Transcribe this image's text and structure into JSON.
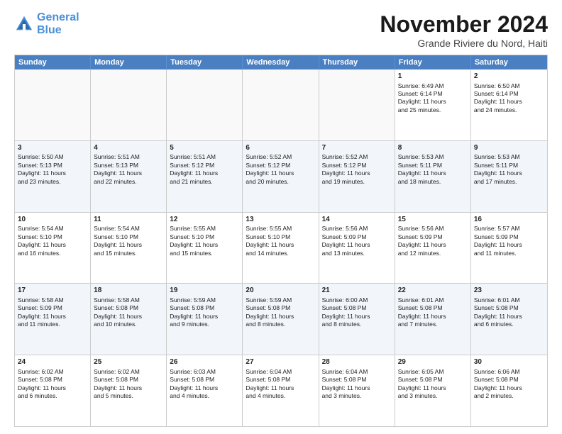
{
  "logo": {
    "line1": "General",
    "line2": "Blue"
  },
  "title": "November 2024",
  "location": "Grande Riviere du Nord, Haiti",
  "header_days": [
    "Sunday",
    "Monday",
    "Tuesday",
    "Wednesday",
    "Thursday",
    "Friday",
    "Saturday"
  ],
  "rows": [
    [
      {
        "day": "",
        "info": ""
      },
      {
        "day": "",
        "info": ""
      },
      {
        "day": "",
        "info": ""
      },
      {
        "day": "",
        "info": ""
      },
      {
        "day": "",
        "info": ""
      },
      {
        "day": "1",
        "info": "Sunrise: 6:49 AM\nSunset: 6:14 PM\nDaylight: 11 hours\nand 25 minutes."
      },
      {
        "day": "2",
        "info": "Sunrise: 6:50 AM\nSunset: 6:14 PM\nDaylight: 11 hours\nand 24 minutes."
      }
    ],
    [
      {
        "day": "3",
        "info": "Sunrise: 5:50 AM\nSunset: 5:13 PM\nDaylight: 11 hours\nand 23 minutes."
      },
      {
        "day": "4",
        "info": "Sunrise: 5:51 AM\nSunset: 5:13 PM\nDaylight: 11 hours\nand 22 minutes."
      },
      {
        "day": "5",
        "info": "Sunrise: 5:51 AM\nSunset: 5:12 PM\nDaylight: 11 hours\nand 21 minutes."
      },
      {
        "day": "6",
        "info": "Sunrise: 5:52 AM\nSunset: 5:12 PM\nDaylight: 11 hours\nand 20 minutes."
      },
      {
        "day": "7",
        "info": "Sunrise: 5:52 AM\nSunset: 5:12 PM\nDaylight: 11 hours\nand 19 minutes."
      },
      {
        "day": "8",
        "info": "Sunrise: 5:53 AM\nSunset: 5:11 PM\nDaylight: 11 hours\nand 18 minutes."
      },
      {
        "day": "9",
        "info": "Sunrise: 5:53 AM\nSunset: 5:11 PM\nDaylight: 11 hours\nand 17 minutes."
      }
    ],
    [
      {
        "day": "10",
        "info": "Sunrise: 5:54 AM\nSunset: 5:10 PM\nDaylight: 11 hours\nand 16 minutes."
      },
      {
        "day": "11",
        "info": "Sunrise: 5:54 AM\nSunset: 5:10 PM\nDaylight: 11 hours\nand 15 minutes."
      },
      {
        "day": "12",
        "info": "Sunrise: 5:55 AM\nSunset: 5:10 PM\nDaylight: 11 hours\nand 15 minutes."
      },
      {
        "day": "13",
        "info": "Sunrise: 5:55 AM\nSunset: 5:10 PM\nDaylight: 11 hours\nand 14 minutes."
      },
      {
        "day": "14",
        "info": "Sunrise: 5:56 AM\nSunset: 5:09 PM\nDaylight: 11 hours\nand 13 minutes."
      },
      {
        "day": "15",
        "info": "Sunrise: 5:56 AM\nSunset: 5:09 PM\nDaylight: 11 hours\nand 12 minutes."
      },
      {
        "day": "16",
        "info": "Sunrise: 5:57 AM\nSunset: 5:09 PM\nDaylight: 11 hours\nand 11 minutes."
      }
    ],
    [
      {
        "day": "17",
        "info": "Sunrise: 5:58 AM\nSunset: 5:09 PM\nDaylight: 11 hours\nand 11 minutes."
      },
      {
        "day": "18",
        "info": "Sunrise: 5:58 AM\nSunset: 5:08 PM\nDaylight: 11 hours\nand 10 minutes."
      },
      {
        "day": "19",
        "info": "Sunrise: 5:59 AM\nSunset: 5:08 PM\nDaylight: 11 hours\nand 9 minutes."
      },
      {
        "day": "20",
        "info": "Sunrise: 5:59 AM\nSunset: 5:08 PM\nDaylight: 11 hours\nand 8 minutes."
      },
      {
        "day": "21",
        "info": "Sunrise: 6:00 AM\nSunset: 5:08 PM\nDaylight: 11 hours\nand 8 minutes."
      },
      {
        "day": "22",
        "info": "Sunrise: 6:01 AM\nSunset: 5:08 PM\nDaylight: 11 hours\nand 7 minutes."
      },
      {
        "day": "23",
        "info": "Sunrise: 6:01 AM\nSunset: 5:08 PM\nDaylight: 11 hours\nand 6 minutes."
      }
    ],
    [
      {
        "day": "24",
        "info": "Sunrise: 6:02 AM\nSunset: 5:08 PM\nDaylight: 11 hours\nand 6 minutes."
      },
      {
        "day": "25",
        "info": "Sunrise: 6:02 AM\nSunset: 5:08 PM\nDaylight: 11 hours\nand 5 minutes."
      },
      {
        "day": "26",
        "info": "Sunrise: 6:03 AM\nSunset: 5:08 PM\nDaylight: 11 hours\nand 4 minutes."
      },
      {
        "day": "27",
        "info": "Sunrise: 6:04 AM\nSunset: 5:08 PM\nDaylight: 11 hours\nand 4 minutes."
      },
      {
        "day": "28",
        "info": "Sunrise: 6:04 AM\nSunset: 5:08 PM\nDaylight: 11 hours\nand 3 minutes."
      },
      {
        "day": "29",
        "info": "Sunrise: 6:05 AM\nSunset: 5:08 PM\nDaylight: 11 hours\nand 3 minutes."
      },
      {
        "day": "30",
        "info": "Sunrise: 6:06 AM\nSunset: 5:08 PM\nDaylight: 11 hours\nand 2 minutes."
      }
    ]
  ]
}
